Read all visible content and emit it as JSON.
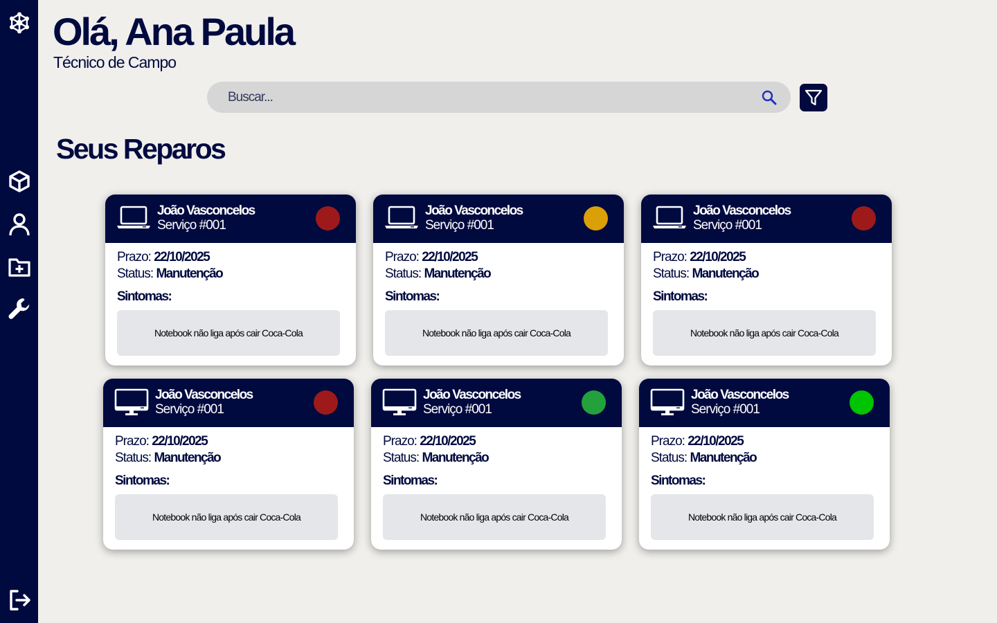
{
  "header": {
    "greeting": "Olá, Ana Paula",
    "role": "Técnico de Campo"
  },
  "search": {
    "placeholder": "Buscar..."
  },
  "section_title": "Seus Reparos",
  "sidebar": {
    "items": [
      {
        "icon": "network-logo-icon"
      },
      {
        "icon": "cube-icon"
      },
      {
        "icon": "user-icon"
      },
      {
        "icon": "folder-add-icon"
      },
      {
        "icon": "wrench-icon"
      },
      {
        "icon": "logout-icon"
      }
    ]
  },
  "colors": {
    "navy": "#000a3f",
    "background": "#f0efec",
    "status_red": "#9e1a1a",
    "status_yellow": "#dba008",
    "status_green_dark": "#23a23b",
    "status_green": "#00c400"
  },
  "labels": {
    "prazo": "Prazo:",
    "status": "Status:",
    "sintomas": "Sintomas:"
  },
  "cards": [
    {
      "device": "laptop-icon",
      "client": "João Vasconcelos",
      "service": "Serviço #001",
      "deadline": "22/10/2025",
      "status": "Manutenção",
      "symptoms": "Notebook não liga após cair Coca-Cola",
      "dot_color": "#9e1a1a"
    },
    {
      "device": "laptop-icon",
      "client": "João Vasconcelos",
      "service": "Serviço #001",
      "deadline": "22/10/2025",
      "status": "Manutenção",
      "symptoms": "Notebook não liga após cair Coca-Cola",
      "dot_color": "#dba008"
    },
    {
      "device": "laptop-icon",
      "client": "João Vasconcelos",
      "service": "Serviço #001",
      "deadline": "22/10/2025",
      "status": "Manutenção",
      "symptoms": "Notebook não liga após cair Coca-Cola",
      "dot_color": "#9e1a1a"
    },
    {
      "device": "monitor-icon",
      "client": "João Vasconcelos",
      "service": "Serviço #001",
      "deadline": "22/10/2025",
      "status": "Manutenção",
      "symptoms": "Notebook não liga após cair Coca-Cola",
      "dot_color": "#9e1a1a"
    },
    {
      "device": "monitor-icon",
      "client": "João Vasconcelos",
      "service": "Serviço #001",
      "deadline": "22/10/2025",
      "status": "Manutenção",
      "symptoms": "Notebook não liga após cair Coca-Cola",
      "dot_color": "#23a23b"
    },
    {
      "device": "monitor-icon",
      "client": "João Vasconcelos",
      "service": "Serviço #001",
      "deadline": "22/10/2025",
      "status": "Manutenção",
      "symptoms": "Notebook não liga após cair Coca-Cola",
      "dot_color": "#00c400"
    }
  ]
}
